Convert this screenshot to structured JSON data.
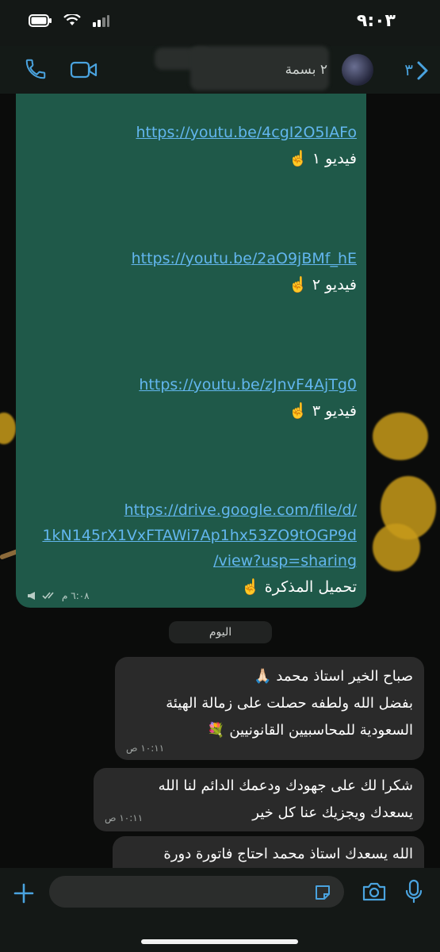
{
  "status_bar": {
    "time": "٩:٠٣"
  },
  "header": {
    "contact_name": "٢ بسمة",
    "back_count": "٣"
  },
  "outgoing": {
    "links": [
      {
        "url": "https://youtu.be/4cgI2O5IAFo",
        "caption": "فيديو ١ ☝️"
      },
      {
        "url": "https://youtu.be/2aO9jBMf_hE",
        "caption": "فيديو ٢ ☝️"
      },
      {
        "url": "https://youtu.be/zJnvF4AjTg0",
        "caption": "فيديو ٣ ☝️"
      }
    ],
    "drive": {
      "line1": "https://drive.google.com/file/d/",
      "line2": "1kN145rX1VxFTAWi7Ap1hx53ZO9tOGP9d",
      "line3": "/view?usp=sharing",
      "caption": "تحميل المذكرة ☝️"
    },
    "time": "٦:٠٨ م"
  },
  "date_divider": "اليوم",
  "incoming": [
    {
      "lines": [
        "صباح الخير استاذ محمد 🙏🏻",
        "بفضل الله ولطفه حصلت على زمالة الهيئة",
        "السعودية للمحاسبيين القانونيين 💐"
      ],
      "time": "١٠:١١ ص"
    },
    {
      "lines": [
        "شكرا لك على جهودك ودعمك الدائم لنا الله",
        "يسعدك ويجزيك عنا كل خير"
      ],
      "time": "١٠:١١ ص"
    },
    {
      "lines": [
        "الله يسعدك استاذ محمد احتاج فاتورة دورة"
      ]
    }
  ],
  "composer": {
    "placeholder": ""
  },
  "colors": {
    "accent": "#4aa3df",
    "outgoing_bubble": "#1f5949",
    "incoming_bubble": "#2a2a2a"
  }
}
